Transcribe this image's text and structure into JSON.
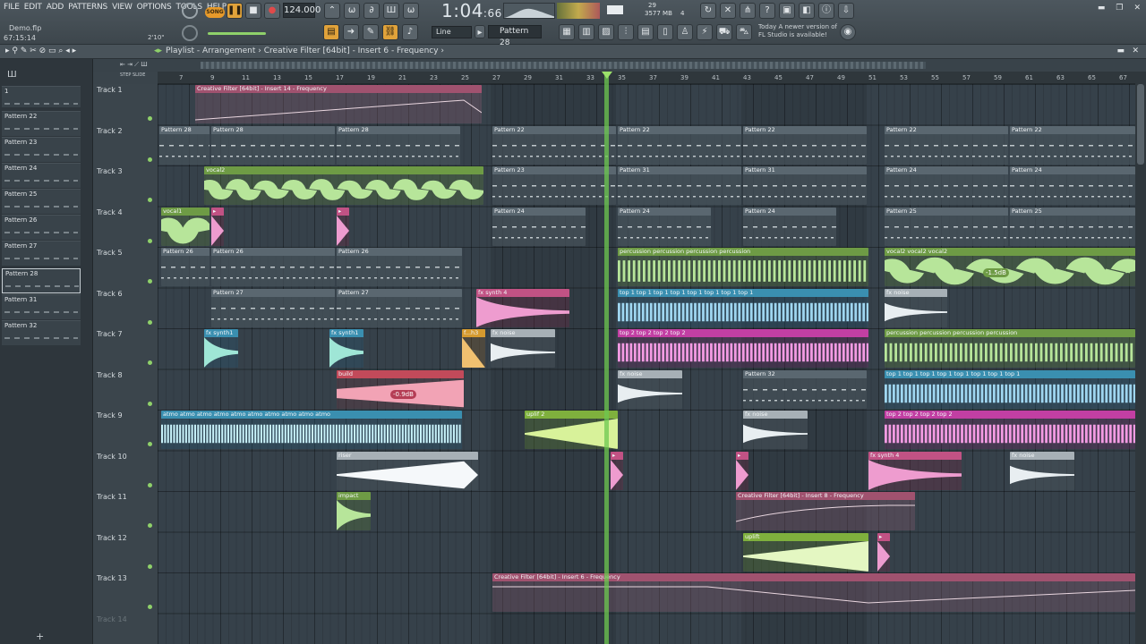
{
  "menu": [
    "FILE",
    "EDIT",
    "ADD",
    "PATTERNS",
    "VIEW",
    "OPTIONS",
    "TOOLS",
    "HELP"
  ],
  "project": {
    "file": "Demo.flp",
    "time": "67:15:14",
    "zoom": "2'10\""
  },
  "transport": {
    "mode": "SONG",
    "tempo": "124.000",
    "clock": "1:04",
    "clock_sub": "66"
  },
  "cpu": {
    "value": "29",
    "mem": "3577 MB",
    "poly": "4"
  },
  "snap": "Line",
  "pattern_selector": "Pattern 28",
  "hint": "Today  A newer version of FL Studio is available!",
  "breadcrumb": {
    "root": "Playlist - Arrangement",
    "path": "Creative Filter [64bit] - Insert 6 - Frequency"
  },
  "step_slide": "STEP  SLIDE",
  "picker": [
    "Pattern 22",
    "Pattern 23",
    "Pattern 24",
    "Pattern 25",
    "Pattern 26",
    "Pattern 27",
    "Pattern 28",
    "Pattern 31",
    "Pattern 32"
  ],
  "tracks": [
    "Track 1",
    "Track 2",
    "Track 3",
    "Track 4",
    "Track 5",
    "Track 6",
    "Track 7",
    "Track 8",
    "Track 9",
    "Track 10",
    "Track 11",
    "Track 12",
    "Track 13",
    "Track 14"
  ],
  "ruler": [
    "7",
    "9",
    "11",
    "13",
    "15",
    "17",
    "19",
    "21",
    "23",
    "25",
    "27",
    "29",
    "31",
    "33",
    "35",
    "37",
    "39",
    "41",
    "43",
    "45",
    "47",
    "49",
    "51",
    "53",
    "55",
    "57",
    "59",
    "61",
    "63",
    "65",
    "67"
  ],
  "clips": {
    "t1": "Creative Filter [64bit] - Insert 14 - Frequency",
    "t8_badge": "-0.9dB",
    "t5_badge": "-1.5dB",
    "t11": "Creative Filter [64bit] - Insert 8 - Frequency",
    "t13": "Creative Filter [64bit] - Insert 6 - Frequency"
  },
  "colors": {
    "green": "#6e9b45",
    "pink": "#c15284",
    "cyan": "#3a8fb0",
    "magenta": "#c23fa3",
    "playhead": "#8fd16a"
  }
}
